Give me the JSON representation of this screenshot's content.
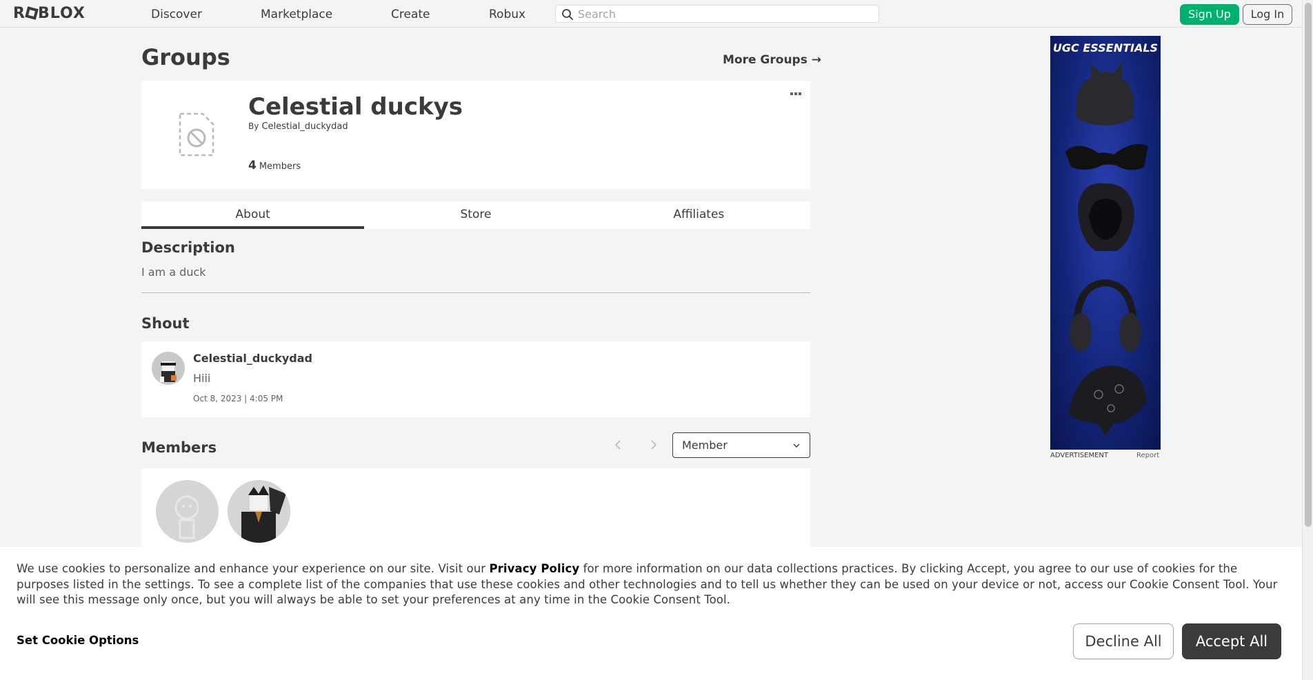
{
  "nav": {
    "logo_pre": "R",
    "logo_post": "BLOX",
    "links": [
      "Discover",
      "Marketplace",
      "Create",
      "Robux"
    ],
    "search_placeholder": "Search",
    "signup_label": "Sign Up",
    "login_label": "Log In"
  },
  "page": {
    "title": "Groups",
    "more_groups": "More Groups →"
  },
  "group": {
    "name": "Celestial duckys",
    "owner_prefix": "By",
    "owner": "Celestial_duckydad",
    "member_count": "4",
    "member_label": "Members"
  },
  "tabs": [
    "About",
    "Store",
    "Affiliates"
  ],
  "about": {
    "description_title": "Description",
    "description_text": "I am a duck",
    "shout_title": "Shout",
    "shout": {
      "user": "Celestial_duckydad",
      "body": "Hiii",
      "date": "Oct 8, 2023 | 4:05 PM"
    },
    "members_title": "Members",
    "role_selected": "Member"
  },
  "ad": {
    "title": "UGC ESSENTIALS",
    "label": "ADVERTISEMENT",
    "report": "Report"
  },
  "cookie": {
    "text_before": "We use cookies to personalize and enhance your experience on our site. Visit our ",
    "link": "Privacy Policy",
    "text_after": " for more information on our data collections practices. By clicking Accept, you agree to our use of cookies for the purposes listed in the settings. To see a complete list of the companies that use these cookies and other technologies and to tell us whether they can be used on your device or not, access our Cookie Consent Tool. Your will see this message only once, but you will always be able to set your preferences at any time in the Cookie Consent Tool.",
    "options": "Set Cookie Options",
    "decline": "Decline All",
    "accept": "Accept All"
  },
  "colors": {
    "background": "#f2f4f5",
    "text": "#393b3d",
    "signup": "#00b06f",
    "card": "#ffffff"
  }
}
